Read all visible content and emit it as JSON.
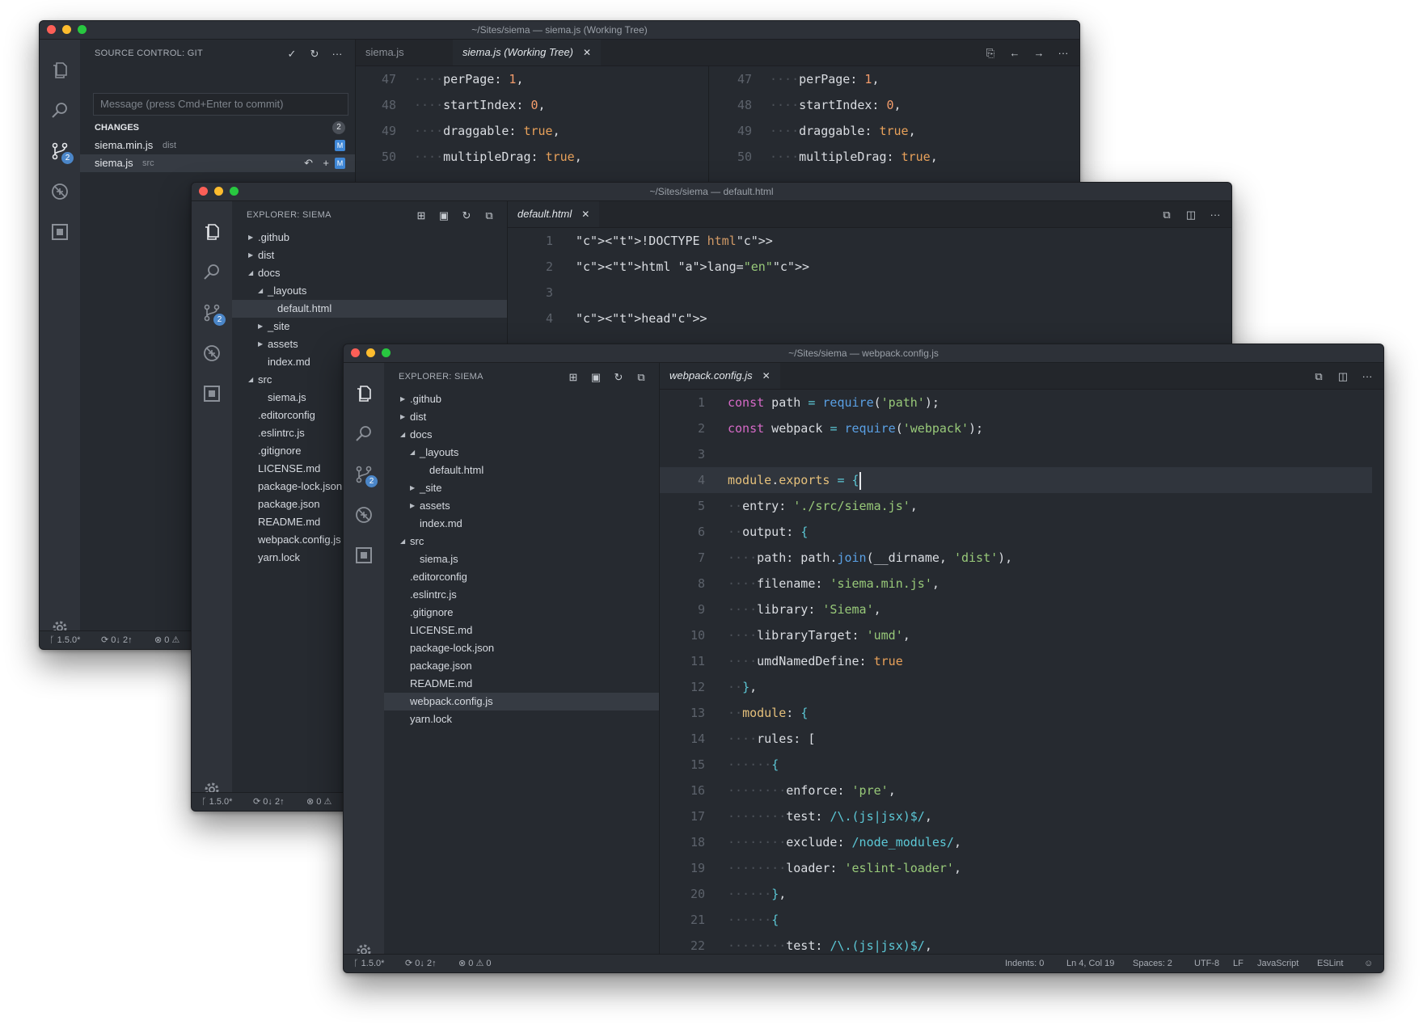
{
  "windows": {
    "back": {
      "title": "~/Sites/siema — siema.js (Working Tree)",
      "sidebar_title": "SOURCE CONTROL: GIT",
      "commit_placeholder": "Message (press Cmd+Enter to commit)",
      "changes_label": "CHANGES",
      "changes_count": "2",
      "files": [
        {
          "name": "siema.min.js",
          "dir": "dist",
          "status": "M"
        },
        {
          "name": "siema.js",
          "dir": "src",
          "status": "M"
        }
      ],
      "tabs": [
        "siema.js",
        "siema.js (Working Tree)"
      ],
      "lines": [
        {
          "n": "47",
          "key": "perPage",
          "val": "1"
        },
        {
          "n": "48",
          "key": "startIndex",
          "val": "0"
        },
        {
          "n": "49",
          "key": "draggable",
          "val": "true"
        },
        {
          "n": "50",
          "key": "multipleDrag",
          "val": "true"
        }
      ],
      "status": {
        "branch": "1.5.0*",
        "sync": "0↓ 2↑",
        "problems": "0"
      }
    },
    "middle": {
      "title": "~/Sites/siema — default.html",
      "sidebar_title": "EXPLORER: SIEMA",
      "tab": "default.html",
      "tree": [
        {
          "label": ".github",
          "depth": 0,
          "caret": "closed"
        },
        {
          "label": "dist",
          "depth": 0,
          "caret": "closed"
        },
        {
          "label": "docs",
          "depth": 0,
          "caret": "open"
        },
        {
          "label": "_layouts",
          "depth": 1,
          "caret": "open"
        },
        {
          "label": "default.html",
          "depth": 2,
          "caret": "",
          "selected": true
        },
        {
          "label": "_site",
          "depth": 1,
          "caret": "closed"
        },
        {
          "label": "assets",
          "depth": 1,
          "caret": "closed"
        },
        {
          "label": "index.md",
          "depth": 1,
          "caret": ""
        },
        {
          "label": "src",
          "depth": 0,
          "caret": "open"
        },
        {
          "label": "siema.js",
          "depth": 1,
          "caret": ""
        },
        {
          "label": ".editorconfig",
          "depth": 0,
          "caret": ""
        },
        {
          "label": ".eslintrc.js",
          "depth": 0,
          "caret": ""
        },
        {
          "label": ".gitignore",
          "depth": 0,
          "caret": ""
        },
        {
          "label": "LICENSE.md",
          "depth": 0,
          "caret": ""
        },
        {
          "label": "package-lock.json",
          "depth": 0,
          "caret": ""
        },
        {
          "label": "package.json",
          "depth": 0,
          "caret": ""
        },
        {
          "label": "README.md",
          "depth": 0,
          "caret": ""
        },
        {
          "label": "webpack.config.js",
          "depth": 0,
          "caret": ""
        },
        {
          "label": "yarn.lock",
          "depth": 0,
          "caret": ""
        }
      ],
      "lines": [
        {
          "n": "1",
          "text": "<!DOCTYPE html>"
        },
        {
          "n": "2",
          "text": "<html lang=\"en\">"
        },
        {
          "n": "3",
          "text": ""
        },
        {
          "n": "4",
          "text": "<head>"
        }
      ],
      "status": {
        "branch": "1.5.0*",
        "sync": "0↓ 2↑",
        "problems": "0"
      }
    },
    "front": {
      "title": "~/Sites/siema — webpack.config.js",
      "sidebar_title": "EXPLORER: SIEMA",
      "tab": "webpack.config.js",
      "tree": [
        {
          "label": ".github",
          "depth": 0,
          "caret": "closed"
        },
        {
          "label": "dist",
          "depth": 0,
          "caret": "closed"
        },
        {
          "label": "docs",
          "depth": 0,
          "caret": "open"
        },
        {
          "label": "_layouts",
          "depth": 1,
          "caret": "open"
        },
        {
          "label": "default.html",
          "depth": 2,
          "caret": ""
        },
        {
          "label": "_site",
          "depth": 1,
          "caret": "closed"
        },
        {
          "label": "assets",
          "depth": 1,
          "caret": "closed"
        },
        {
          "label": "index.md",
          "depth": 1,
          "caret": ""
        },
        {
          "label": "src",
          "depth": 0,
          "caret": "open"
        },
        {
          "label": "siema.js",
          "depth": 1,
          "caret": ""
        },
        {
          "label": ".editorconfig",
          "depth": 0,
          "caret": ""
        },
        {
          "label": ".eslintrc.js",
          "depth": 0,
          "caret": ""
        },
        {
          "label": ".gitignore",
          "depth": 0,
          "caret": ""
        },
        {
          "label": "LICENSE.md",
          "depth": 0,
          "caret": ""
        },
        {
          "label": "package-lock.json",
          "depth": 0,
          "caret": ""
        },
        {
          "label": "package.json",
          "depth": 0,
          "caret": ""
        },
        {
          "label": "README.md",
          "depth": 0,
          "caret": ""
        },
        {
          "label": "webpack.config.js",
          "depth": 0,
          "caret": "",
          "selected": true
        },
        {
          "label": "yarn.lock",
          "depth": 0,
          "caret": ""
        }
      ],
      "code": [
        "const path = require('path');",
        "const webpack = require('webpack');",
        "",
        "module.exports = {",
        "  entry: './src/siema.js',",
        "  output: {",
        "    path: path.join(__dirname, 'dist'),",
        "    filename: 'siema.min.js',",
        "    library: 'Siema',",
        "    libraryTarget: 'umd',",
        "    umdNamedDefine: true",
        "  },",
        "  module: {",
        "    rules: [",
        "      {",
        "        enforce: 'pre',",
        "        test: /\\.(js|jsx)$/,",
        "        exclude: /node_modules/,",
        "        loader: 'eslint-loader',",
        "      },",
        "      {",
        "        test: /\\.(js|jsx)$/,"
      ],
      "status": {
        "branch": "1.5.0*",
        "sync": "0↓ 2↑",
        "errors": "0",
        "warnings": "0",
        "indents": "Indents: 0",
        "position": "Ln 4, Col 19",
        "spaces": "Spaces: 2",
        "encoding": "UTF-8",
        "eol": "LF",
        "language": "JavaScript",
        "linter": "ESLint"
      }
    }
  },
  "icons": [
    "files-icon",
    "search-icon",
    "source-control-icon",
    "debug-icon",
    "extensions-icon",
    "gear-icon"
  ],
  "colors": {
    "editor_bg": "#262a30",
    "activity_bg": "#2f333a",
    "badge": "#4b86c8"
  }
}
